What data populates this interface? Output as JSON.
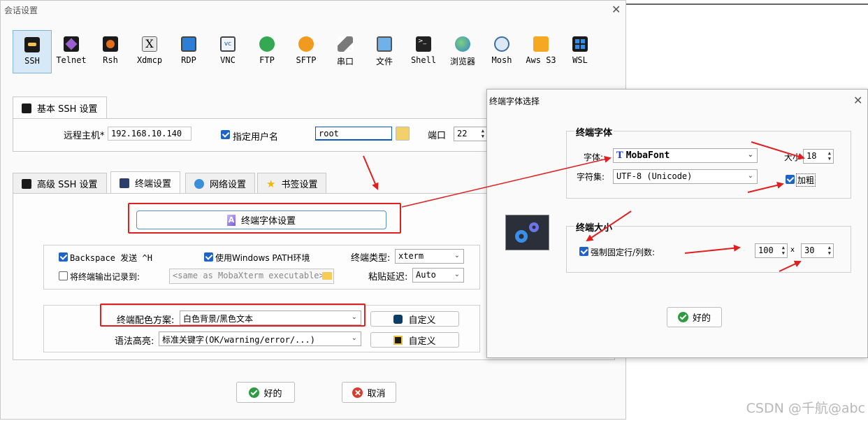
{
  "main_dialog": {
    "title": "会话设置",
    "session_types": [
      {
        "label": "SSH",
        "icon": "key-icon",
        "selected": true
      },
      {
        "label": "Telnet",
        "icon": "telnet-icon"
      },
      {
        "label": "Rsh",
        "icon": "rsh-icon"
      },
      {
        "label": "Xdmcp",
        "icon": "xdmcp-icon"
      },
      {
        "label": "RDP",
        "icon": "rdp-monitor-icon"
      },
      {
        "label": "VNC",
        "icon": "vnc-icon"
      },
      {
        "label": "FTP",
        "icon": "ftp-globe-icon"
      },
      {
        "label": "SFTP",
        "icon": "sftp-globe-icon"
      },
      {
        "label": "串口",
        "icon": "serial-plug-icon"
      },
      {
        "label": "文件",
        "icon": "file-icon"
      },
      {
        "label": "Shell",
        "icon": "shell-terminal-icon"
      },
      {
        "label": "浏览器",
        "icon": "browser-globe-icon"
      },
      {
        "label": "Mosh",
        "icon": "mosh-satellite-icon"
      },
      {
        "label": "Aws S3",
        "icon": "aws-cubes-icon"
      },
      {
        "label": "WSL",
        "icon": "windows-icon"
      }
    ],
    "basic_tab": {
      "label": "基本 SSH 设置",
      "remote_host_label": "远程主机*",
      "remote_host_value": "192.168.10.140",
      "specify_user_label": "指定用户名",
      "specify_user_checked": true,
      "username_value": "root",
      "port_label": "端口",
      "port_value": "22"
    },
    "tabs": [
      {
        "label": "高级 SSH 设置",
        "icon": "key-icon"
      },
      {
        "label": "终端设置",
        "icon": "terminal-settings-icon",
        "active": true
      },
      {
        "label": "网络设置",
        "icon": "network-icon"
      },
      {
        "label": "书签设置",
        "icon": "star-icon"
      }
    ],
    "terminal": {
      "font_settings_button": "终端字体设置",
      "backspace_label": "Backspace 发送 ^H",
      "backspace_checked": true,
      "use_windows_path_label": "使用Windows PATH环境",
      "use_windows_path_checked": true,
      "terminal_type_label": "终端类型:",
      "terminal_type_value": "xterm",
      "log_output_label": "将终端输出记录到:",
      "log_output_checked": false,
      "log_path_placeholder": "<same as MobaXterm executable>",
      "paste_delay_label": "粘贴延迟:",
      "paste_delay_value": "Auto",
      "color_scheme_label": "终端配色方案:",
      "color_scheme_value": "白色背景/黑色文本",
      "customize_label_1": "自定义",
      "syntax_label": "语法高亮:",
      "syntax_value": "标准关键字(OK/warning/error/...)",
      "customize_label_2": "自定义"
    },
    "ok_label": "好的",
    "cancel_label": "取消"
  },
  "font_dialog": {
    "title": "终端字体选择",
    "font_group_title": "终端字体",
    "font_label": "字体:",
    "font_value": "MobaFont",
    "size_label": "大小",
    "size_value": "18",
    "charset_label": "字符集:",
    "charset_value": "UTF-8 (Unicode)",
    "bold_label": "加粗",
    "bold_checked": true,
    "size_group_title": "终端大小",
    "fixed_size_label": "强制固定行/列数:",
    "fixed_size_checked": true,
    "cols_value": "100",
    "times": "x",
    "rows_value": "30",
    "ok_label": "好的"
  },
  "watermark": "CSDN @千航@abc",
  "colors": {
    "selection_bg": "#d7e9f7",
    "checkbox_blue": "#1f63c6",
    "annotation_red": "#e02020",
    "ok_green": "#2e9a42",
    "cancel_red": "#d83b2e"
  }
}
